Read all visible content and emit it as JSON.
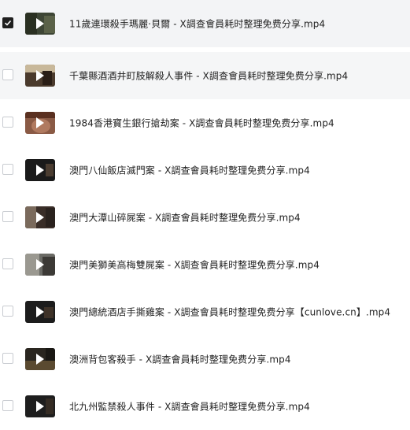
{
  "files": [
    {
      "name": "11歲連環殺手瑪麗·貝爾 - X調查會員耗时整理免费分享.mp4",
      "checked": true,
      "thumb_bg": "#3d4535"
    },
    {
      "name": "千葉縣酒酒井町肢解殺人事件 - X調查會員耗时整理免费分享.mp4",
      "checked": false,
      "thumb_bg": "#4a3a2c"
    },
    {
      "name": "1984香港寶生銀行搶劫案 - X調查會員耗时整理免费分享.mp4",
      "checked": false,
      "thumb_bg": "#8a5a45"
    },
    {
      "name": "澳門八仙飯店滅門案 - X調查會員耗时整理免费分享.mp4",
      "checked": false,
      "thumb_bg": "#1a1a1a"
    },
    {
      "name": "澳門大潭山碎屍案 - X調查會員耗时整理免费分享.mp4",
      "checked": false,
      "thumb_bg": "#3a2e28"
    },
    {
      "name": "澳門美獅美高梅雙屍案 - X調查會員耗时整理免费分享.mp4",
      "checked": false,
      "thumb_bg": "#6b6b66"
    },
    {
      "name": "澳門總統酒店手撕雞案 - X調查會員耗时整理免费分享【cunlove.cn】.mp4",
      "checked": false,
      "thumb_bg": "#1c1c1c"
    },
    {
      "name": "澳洲背包客殺手 - X調查會員耗时整理免费分享.mp4",
      "checked": false,
      "thumb_bg": "#2a2620"
    },
    {
      "name": "北九州監禁殺人事件 - X調查會員耗时整理免费分享.mp4",
      "checked": false,
      "thumb_bg": "#1e1e1e"
    }
  ],
  "icons": {
    "checkbox_checked": "checkmark-icon",
    "play": "play-icon"
  }
}
